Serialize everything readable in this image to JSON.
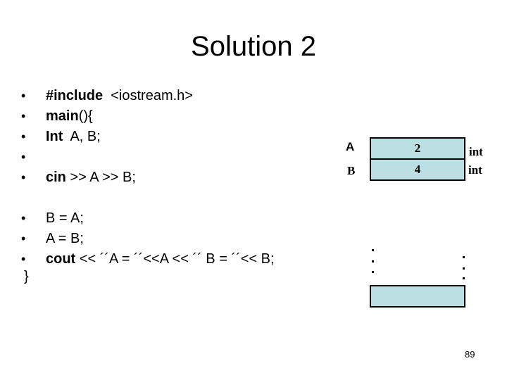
{
  "slide": {
    "title": "Solution 2",
    "page_number": "89",
    "bullet_glyph": "•"
  },
  "code_block_1": [
    {
      "kw": "#include",
      "rest": "  <iostream.h>"
    },
    {
      "kw": "main",
      "rest": "(){"
    },
    {
      "kw": "Int",
      "rest": "  A, B;"
    },
    {
      "kw": "",
      "rest": ""
    },
    {
      "kw": "cin",
      "rest": " >> A >> B;"
    }
  ],
  "code_block_2": [
    {
      "kw": "",
      "rest": "B = A;"
    },
    {
      "kw": "",
      "rest": "A = B;"
    },
    {
      "kw": "cout",
      "rest": " << ´´A = ´´<<A << ´´ B = ´´<< B;"
    }
  ],
  "closing_brace": "}",
  "memory_diagram": {
    "cells": [
      {
        "name": "A",
        "value": "2",
        "type": "int"
      },
      {
        "name": "B",
        "value": "4",
        "type": "int"
      }
    ],
    "cell_color": "#bcdfe3"
  }
}
